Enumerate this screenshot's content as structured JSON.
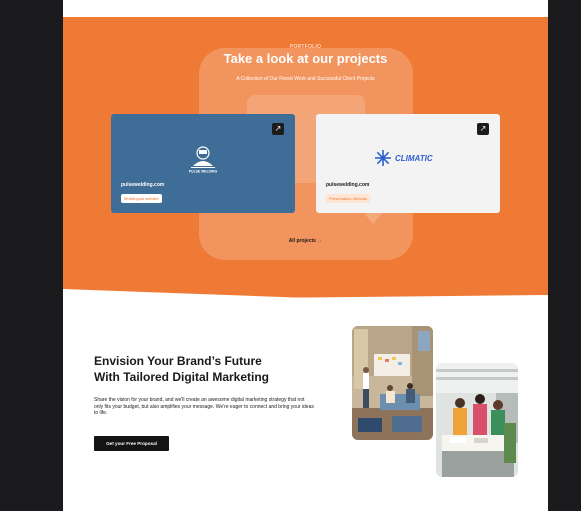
{
  "portfolio": {
    "eyebrow": "PORTFOLIO",
    "title": "Take a look at our projects",
    "subtitle": "A Collection of Our Finest Work and Successful Client Projects",
    "all_projects_label": "All projects →",
    "cards": [
      {
        "site": "pulsewelding.com",
        "tag": "Multilingual website",
        "logo_text": "PULSE WELDING",
        "arrow_icon": "arrow-up-right-icon"
      },
      {
        "site": "pulsewelding.com",
        "tag": "Presentation Website",
        "logo_text": "CLIMATIC",
        "arrow_icon": "arrow-up-right-icon"
      }
    ]
  },
  "promo": {
    "title_line1": "Envision Your Brand’s Future",
    "title_line2": "With Tailored Digital Marketing",
    "description": "Share the vision for your brand, and we'll create an awesome digital marketing strategy that not only fits your budget, but also amplifies your message. We're eager to connect and bring your ideas to life.",
    "cta_label": "Get your Free Proposal"
  },
  "colors": {
    "accent": "#ef7a35",
    "card_blue": "#3e6d98",
    "background": "#1b1b1d",
    "climatic_blue": "#2f5fd0"
  }
}
